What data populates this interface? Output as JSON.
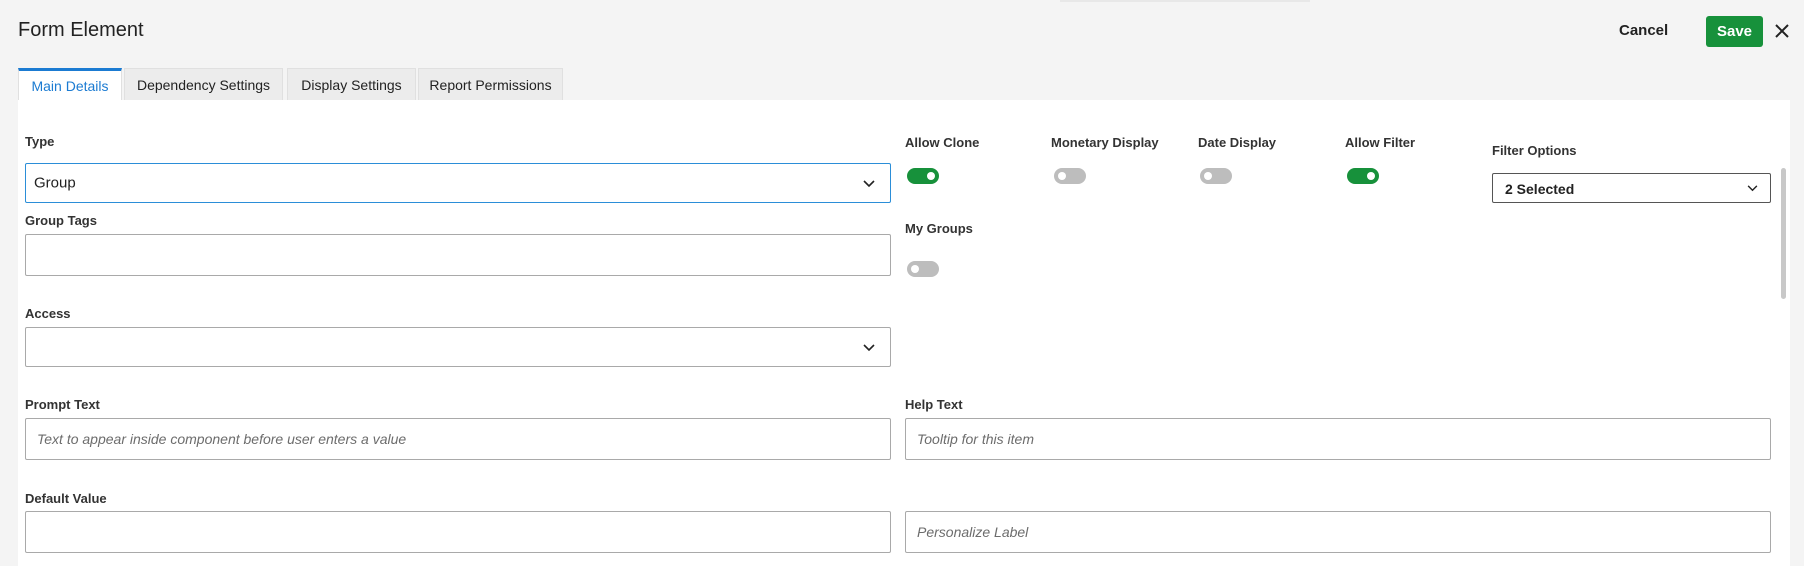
{
  "header": {
    "title": "Form Element",
    "cancel_label": "Cancel",
    "save_label": "Save"
  },
  "tabs": [
    {
      "label": "Main Details",
      "active": true
    },
    {
      "label": "Dependency Settings",
      "active": false
    },
    {
      "label": "Display Settings",
      "active": false
    },
    {
      "label": "Report Permissions",
      "active": false
    }
  ],
  "form": {
    "type": {
      "label": "Type",
      "value": "Group"
    },
    "group_tags": {
      "label": "Group Tags",
      "value": ""
    },
    "access": {
      "label": "Access",
      "value": ""
    },
    "prompt_text": {
      "label": "Prompt Text",
      "placeholder": "Text to appear inside component before user enters a value"
    },
    "help_text": {
      "label": "Help Text",
      "placeholder": "Tooltip for this item"
    },
    "default_value": {
      "label": "Default Value",
      "value": ""
    },
    "personalize_label": {
      "placeholder": "Personalize Label"
    },
    "toggles": {
      "allow_clone": {
        "label": "Allow Clone",
        "on": true
      },
      "monetary_display": {
        "label": "Monetary Display",
        "on": false
      },
      "date_display": {
        "label": "Date Display",
        "on": false
      },
      "allow_filter": {
        "label": "Allow Filter",
        "on": true
      },
      "my_groups": {
        "label": "My Groups",
        "on": false
      }
    },
    "filter_options": {
      "label": "Filter Options",
      "value": "2 Selected"
    }
  },
  "colors": {
    "accent": "#1b7bd2",
    "save_green": "#17913b",
    "toggle_off": "#bdbdbd"
  },
  "icons": {
    "close": "close-icon",
    "chevron": "chevron-down-icon"
  }
}
